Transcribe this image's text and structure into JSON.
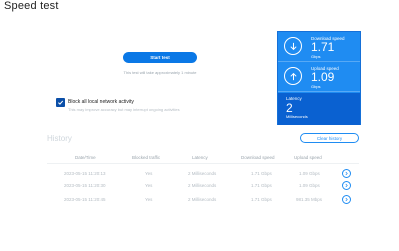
{
  "app": {
    "title": "Speed test"
  },
  "start": {
    "button_label": "Start test",
    "hint": "This test will take approximately 1 minute"
  },
  "block": {
    "checked": true,
    "label": "Block all local network activity",
    "sub": "This may improve accuracy but may interrupt ongoing activities"
  },
  "results": {
    "download": {
      "label": "Download speed",
      "value": "1.71",
      "unit": "Gbps",
      "icon": "download-arrow-icon"
    },
    "upload": {
      "label": "Upload speed",
      "value": "1.09",
      "unit": "Gbps",
      "icon": "upload-arrow-icon"
    },
    "latency": {
      "label": "Latency",
      "value": "2",
      "unit": "Milliseconds"
    }
  },
  "history": {
    "title": "History",
    "clear_label": "Clear history",
    "columns": [
      "Date/Time",
      "Blocked traffic",
      "Latency",
      "Download speed",
      "Upload speed"
    ],
    "rows": [
      {
        "datetime": "2023-05-15 11:20:13",
        "blocked": "Yes",
        "latency": "2 Milliseconds",
        "download": "1.71 Gbps",
        "upload": "1.09 Gbps"
      },
      {
        "datetime": "2023-05-15 11:20:30",
        "blocked": "Yes",
        "latency": "2 Milliseconds",
        "download": "1.71 Gbps",
        "upload": "1.09 Gbps"
      },
      {
        "datetime": "2023-05-15 11:20:45",
        "blocked": "Yes",
        "latency": "2 Milliseconds",
        "download": "1.71 Gbps",
        "upload": "981.35 Mbps"
      }
    ]
  },
  "colors": {
    "accent": "#1f8cf2",
    "accent_dark": "#0a61d1",
    "button": "#0a78e6",
    "checkbox": "#0b4fa8"
  }
}
